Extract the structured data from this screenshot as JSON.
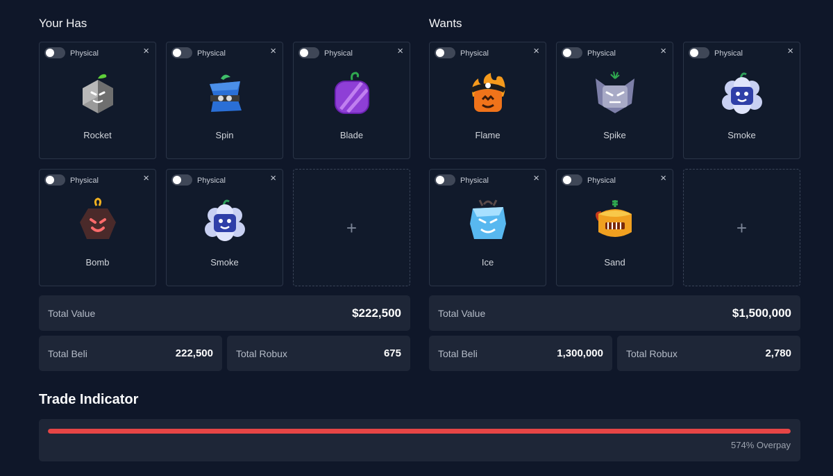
{
  "left": {
    "title": "Your Has",
    "items": [
      {
        "name": "Rocket",
        "toggle_label": "Physical",
        "icon": "rocket-fruit-icon"
      },
      {
        "name": "Spin",
        "toggle_label": "Physical",
        "icon": "spin-fruit-icon"
      },
      {
        "name": "Blade",
        "toggle_label": "Physical",
        "icon": "blade-fruit-icon"
      },
      {
        "name": "Bomb",
        "toggle_label": "Physical",
        "icon": "bomb-fruit-icon"
      },
      {
        "name": "Smoke",
        "toggle_label": "Physical",
        "icon": "smoke-fruit-icon"
      }
    ],
    "add_label": "+",
    "total_value_label": "Total Value",
    "total_value": "$222,500",
    "total_beli_label": "Total Beli",
    "total_beli": "222,500",
    "total_robux_label": "Total Robux",
    "total_robux": "675"
  },
  "right": {
    "title": "Wants",
    "items": [
      {
        "name": "Flame",
        "toggle_label": "Physical",
        "icon": "flame-fruit-icon"
      },
      {
        "name": "Spike",
        "toggle_label": "Physical",
        "icon": "spike-fruit-icon"
      },
      {
        "name": "Smoke",
        "toggle_label": "Physical",
        "icon": "smoke-fruit-icon"
      },
      {
        "name": "Ice",
        "toggle_label": "Physical",
        "icon": "ice-fruit-icon"
      },
      {
        "name": "Sand",
        "toggle_label": "Physical",
        "icon": "sand-fruit-icon"
      }
    ],
    "add_label": "+",
    "total_value_label": "Total Value",
    "total_value": "$1,500,000",
    "total_beli_label": "Total Beli",
    "total_beli": "1,300,000",
    "total_robux_label": "Total Robux",
    "total_robux": "2,780"
  },
  "close_glyph": "×",
  "trade": {
    "title": "Trade Indicator",
    "status": "574% Overpay",
    "fill_fraction": 1.0,
    "bar_color": "#e64545"
  }
}
